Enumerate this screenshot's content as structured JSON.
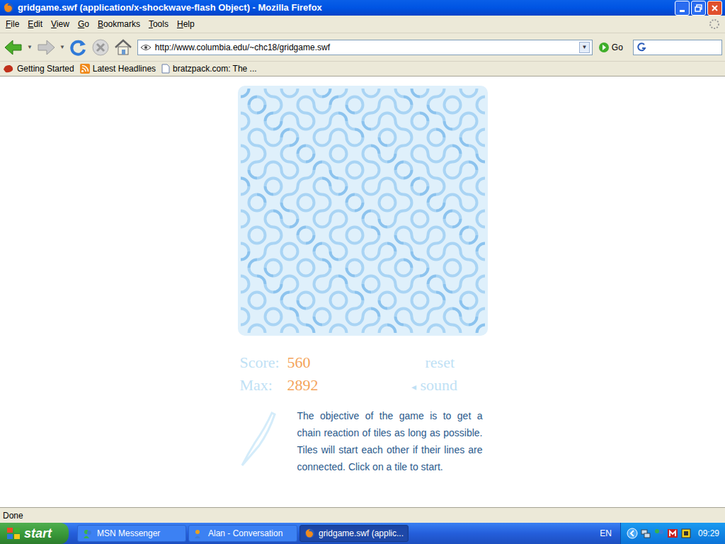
{
  "window": {
    "title": "gridgame.swf (application/x-shockwave-flash Object) - Mozilla Firefox"
  },
  "menu": [
    "File",
    "Edit",
    "View",
    "Go",
    "Bookmarks",
    "Tools",
    "Help"
  ],
  "toolbar": {
    "url": "http://www.columbia.edu/~chc18/gridgame.swf",
    "go": "Go"
  },
  "bookmarks": [
    "Getting Started",
    "Latest Headlines",
    "bratzpack.com: The ..."
  ],
  "game": {
    "tiles": [
      [
        0,
        1,
        1,
        0,
        1,
        0,
        0,
        1,
        0,
        1,
        1,
        0,
        0,
        1,
        0
      ],
      [
        1,
        0,
        0,
        1,
        1,
        0,
        1,
        0,
        0,
        1,
        0,
        1,
        1,
        0,
        1
      ],
      [
        0,
        1,
        0,
        1,
        0,
        0,
        1,
        1,
        0,
        1,
        1,
        0,
        1,
        0,
        0
      ],
      [
        1,
        1,
        0,
        0,
        1,
        0,
        1,
        0,
        1,
        0,
        0,
        1,
        0,
        1,
        1
      ],
      [
        0,
        0,
        1,
        1,
        0,
        1,
        0,
        1,
        1,
        0,
        1,
        1,
        0,
        0,
        1
      ],
      [
        1,
        0,
        1,
        0,
        0,
        1,
        1,
        0,
        0,
        1,
        0,
        1,
        1,
        0,
        0
      ],
      [
        0,
        1,
        0,
        0,
        1,
        1,
        0,
        1,
        0,
        1,
        1,
        0,
        0,
        1,
        1
      ],
      [
        1,
        0,
        1,
        1,
        0,
        0,
        1,
        0,
        1,
        0,
        0,
        1,
        0,
        1,
        0
      ],
      [
        0,
        1,
        1,
        0,
        1,
        0,
        0,
        1,
        1,
        0,
        1,
        0,
        1,
        0,
        1
      ],
      [
        1,
        0,
        0,
        1,
        0,
        1,
        1,
        0,
        0,
        1,
        1,
        0,
        0,
        1,
        0
      ],
      [
        0,
        0,
        1,
        0,
        1,
        1,
        0,
        1,
        0,
        0,
        1,
        1,
        0,
        1,
        1
      ],
      [
        1,
        1,
        0,
        1,
        0,
        0,
        1,
        0,
        1,
        1,
        0,
        0,
        1,
        0,
        0
      ],
      [
        0,
        1,
        0,
        0,
        1,
        0,
        1,
        1,
        0,
        1,
        0,
        1,
        1,
        0,
        1
      ],
      [
        1,
        0,
        1,
        1,
        0,
        1,
        0,
        0,
        1,
        0,
        1,
        0,
        0,
        1,
        0
      ],
      [
        0,
        1,
        0,
        1,
        1,
        0,
        1,
        0,
        0,
        1,
        1,
        0,
        1,
        1,
        0
      ]
    ],
    "score_label": "Score:",
    "score": "560",
    "max_label": "Max:",
    "max": "2892",
    "reset": "reset",
    "sound_icon": "◂",
    "sound": "sound",
    "instructions": "The objective of the game is to get a chain reaction of tiles as long as possible. Tiles will start each other if their lines are connected. Click on a tile to start."
  },
  "status_bar": "Done",
  "taskbar": {
    "start": "start",
    "tasks": [
      {
        "label": "MSN Messenger",
        "selected": false
      },
      {
        "label": "Alan - Conversation",
        "selected": false
      },
      {
        "label": "gridgame.swf (applic...",
        "selected": true
      }
    ],
    "language": "EN",
    "clock": "09:29"
  }
}
